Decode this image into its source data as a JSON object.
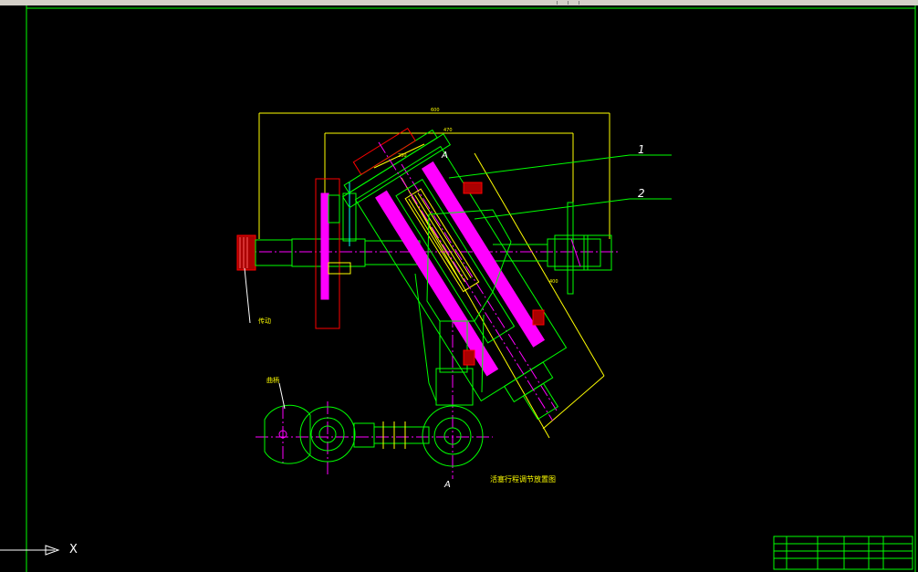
{
  "window": {
    "title": ""
  },
  "drawing": {
    "view_title": "活塞行程调节放置图",
    "callouts": [
      "1",
      "2"
    ],
    "section_mark": "A",
    "labels": {
      "left_part": "传动",
      "crank": "曲柄"
    },
    "dimension_texts": [
      "600",
      "470",
      "400",
      "250"
    ]
  },
  "ucs": {
    "x_label": "X"
  },
  "title_block": {
    "cells": [
      "",
      "",
      "",
      "",
      "",
      "",
      "",
      "",
      ""
    ]
  },
  "colors": {
    "background": "#000000",
    "border": "#00ff00",
    "dimension": "#ffff00",
    "part": "#ff00ff",
    "outline": "#00ff00",
    "center": "#ff00ff",
    "hatch": "#ff0000",
    "detail": "#00ffff"
  }
}
